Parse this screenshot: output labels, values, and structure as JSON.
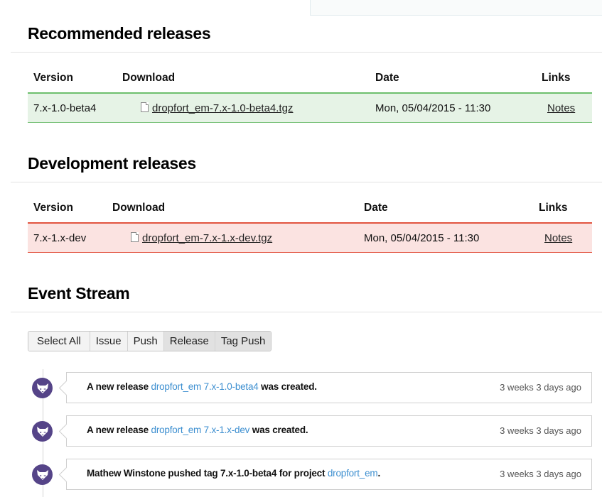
{
  "recommended": {
    "title": "Recommended releases",
    "headers": {
      "version": "Version",
      "download": "Download",
      "date": "Date",
      "links": "Links"
    },
    "rows": [
      {
        "version": "7.x-1.0-beta4",
        "file": "dropfort_em-7.x-1.0-beta4.tgz",
        "file_icon": "file-icon",
        "date": "Mon, 05/04/2015 - 11:30",
        "notes": "Notes"
      }
    ],
    "accent": "#6dbf6d",
    "row_bg": "#e6f3e6"
  },
  "development": {
    "title": "Development releases",
    "headers": {
      "version": "Version",
      "download": "Download",
      "date": "Date",
      "links": "Links"
    },
    "rows": [
      {
        "version": "7.x-1.x-dev",
        "file": "dropfort_em-7.x-1.x-dev.tgz",
        "file_icon": "file-icon",
        "date": "Mon, 05/04/2015 - 11:30",
        "notes": "Notes"
      }
    ],
    "accent": "#e2533f",
    "row_bg": "#fbe3e1"
  },
  "event_stream": {
    "title": "Event Stream",
    "filters": [
      {
        "label": "Select All",
        "active": false
      },
      {
        "label": "Issue",
        "active": false
      },
      {
        "label": "Push",
        "active": false
      },
      {
        "label": "Release",
        "active": true
      },
      {
        "label": "Tag Push",
        "active": true
      }
    ],
    "events": [
      {
        "avatar_icon": "fox-avatar-icon",
        "prefix": "A new release ",
        "link": "dropfort_em 7.x-1.0-beta4",
        "suffix": " was created.",
        "time": "3 weeks 3 days ago"
      },
      {
        "avatar_icon": "fox-avatar-icon",
        "prefix": "A new release ",
        "link": "dropfort_em 7.x-1.x-dev",
        "suffix": " was created.",
        "time": "3 weeks 3 days ago"
      },
      {
        "avatar_icon": "fox-avatar-icon",
        "prefix": "Mathew Winstone pushed tag 7.x-1.0-beta4 for project ",
        "link": "dropfort_em",
        "suffix": ".",
        "time": "3 weeks 3 days ago"
      }
    ],
    "link_color": "#3d8fd0",
    "avatar_color": "#554488"
  }
}
